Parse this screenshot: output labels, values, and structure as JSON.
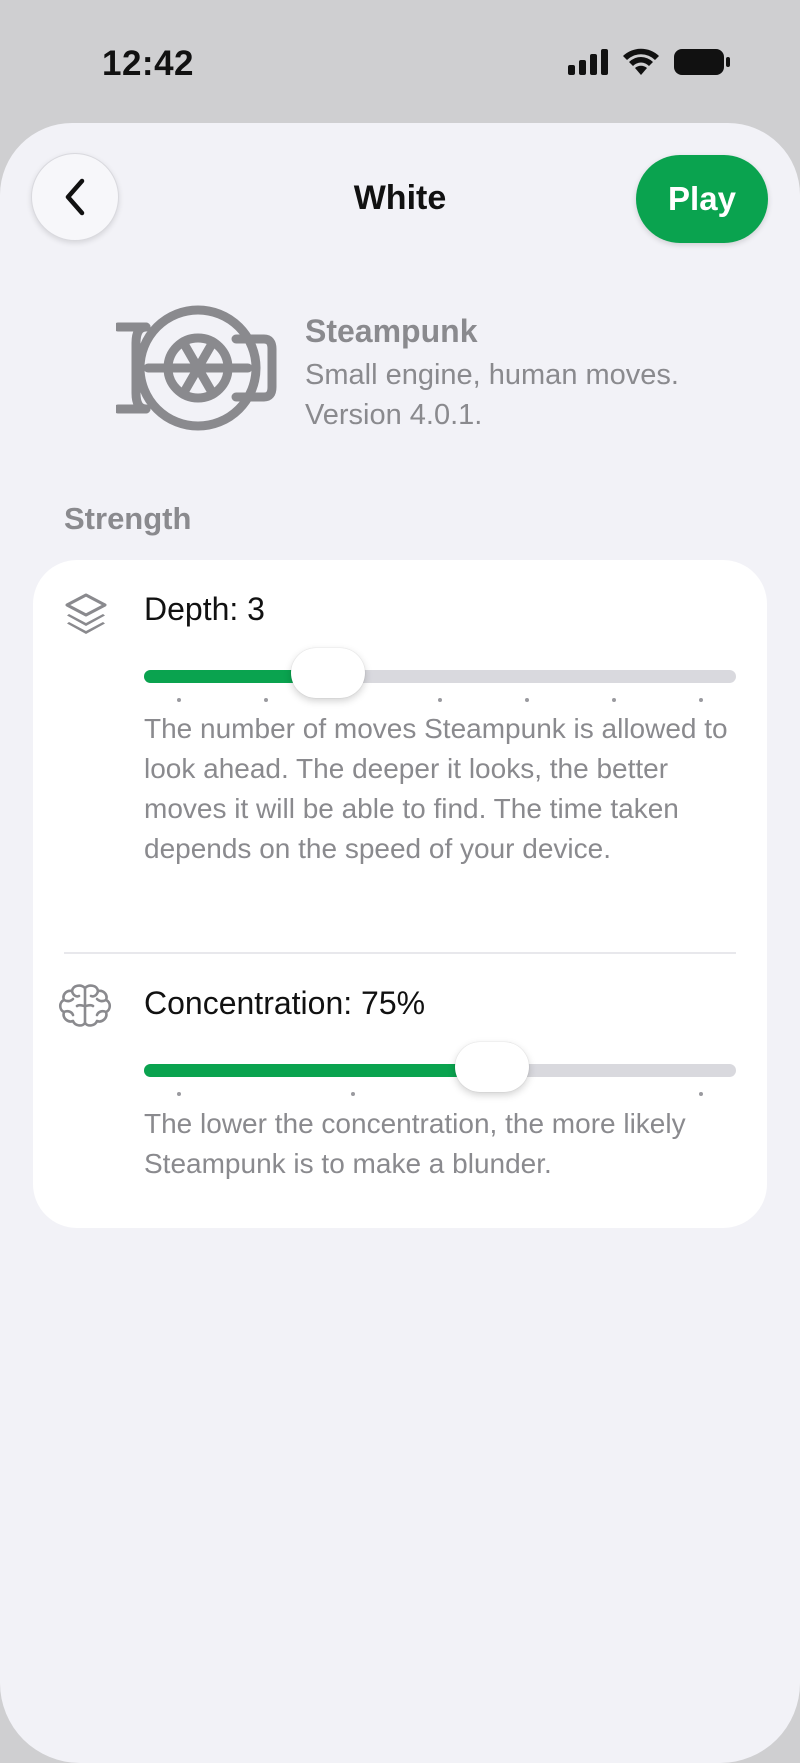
{
  "status": {
    "time": "12:42"
  },
  "header": {
    "title": "White",
    "play_label": "Play"
  },
  "engine": {
    "name": "Steampunk",
    "desc_line1": "Small engine, human moves.",
    "desc_line2": "Version 4.0.1."
  },
  "strength": {
    "section_title": "Strength",
    "depth": {
      "label": "Depth: 3",
      "value": 3,
      "min": 1,
      "max": 8,
      "description": "The number of moves Steampunk is allowed to look ahead. The deeper it looks, the better moves it will be able to find. The time taken depends on the speed of your device."
    },
    "concentration": {
      "label": "Concentration: 75%",
      "value_fraction": 0.6,
      "description": "The lower the concentration, the more likely Steampunk is to make a blunder."
    }
  },
  "colors": {
    "accent": "#0aa34f",
    "background": "#f2f2f7",
    "secondary_text": "#8a8a8e"
  }
}
